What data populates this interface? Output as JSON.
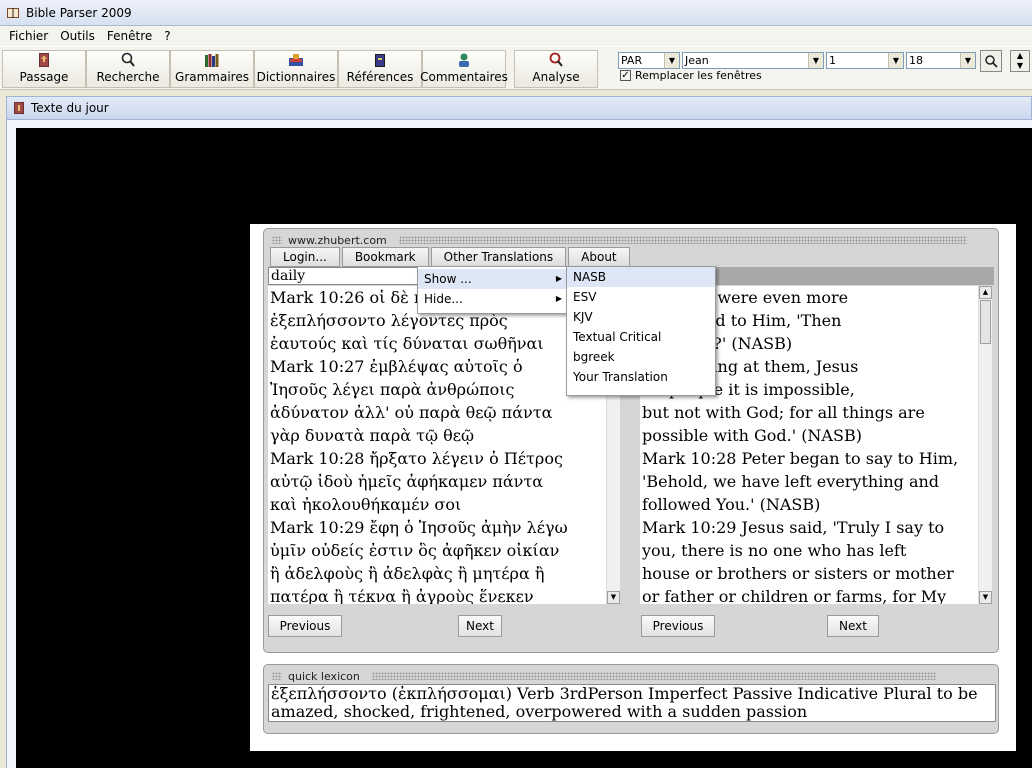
{
  "window": {
    "title": "Bible Parser 2009"
  },
  "menubar": {
    "items": [
      "Fichier",
      "Outils",
      "Fenêtre",
      "?"
    ]
  },
  "toolbar": {
    "buttons": [
      "Passage",
      "Recherche",
      "Grammaires",
      "Dictionnaires",
      "Références",
      "Commentaires",
      "Analyse"
    ],
    "version_select": "PAR",
    "book_select": "Jean",
    "chapter_select": "1",
    "verse_select": "18",
    "replace_windows_label": "Remplacer les fenêtres",
    "replace_windows_checked": true
  },
  "child_window": {
    "title": "Texte du jour"
  },
  "site": {
    "domain": "www.zhubert.com",
    "nav": [
      "Login...",
      "Bookmark",
      "Other Translations",
      "About"
    ],
    "daily_value": "daily"
  },
  "menu": {
    "show_label": "Show ...",
    "hide_label": "Hide...",
    "translations": [
      "NASB",
      "ESV",
      "KJV",
      "Textual Critical",
      "bgreek",
      "Your Translation"
    ]
  },
  "greek_lines": [
    "Mark 10:26 οἱ δὲ π",
    "ἐξεπλήσσοντο λέγοντες πρὸς",
    "ἑαυτούς καὶ τίς δύναται σωθῆναι",
    "Mark 10:27 ἐμβλέψας αὐτοῖς ὁ",
    "Ἰησοῦς λέγει παρὰ ἀνθρώποις",
    "ἀδύνατον ἀλλ' οὐ παρὰ θεῷ πάντα",
    "γὰρ δυνατὰ παρὰ τῷ θεῷ",
    "Mark 10:28 ἤρξατο λέγειν ὁ Πέτρος",
    "αὐτῷ ἰδοὺ ἡμεῖς ἀφήκαμεν πάντα",
    "καὶ ἠκολουθήκαμέν σοι",
    "Mark 10:29 ἔφη ὁ Ἰησοῦς ἀμὴν λέγω",
    "ὑμῖν οὐδείς ἐστιν ὃς ἀφῆκεν οἰκίαν",
    "ἢ ἀδελφοὺς ἢ ἀδελφὰς ἢ μητέρα ἢ",
    "πατέρα ἢ τέκνα ἢ ἀγροὺς ἕνεκεν"
  ],
  "english_lines": [
    ":26 They were even more",
    "d and said to Him, 'Then",
    "be saved?' (NASB)",
    ":27 Looking at them, Jesus",
    "ith people it is impossible,",
    "but not with God; for all things are",
    "possible with God.' (NASB)",
    "Mark 10:28 Peter began to say to Him,",
    "'Behold, we have left everything and",
    "followed You.' (NASB)",
    "Mark 10:29 Jesus said, 'Truly I say to",
    "you, there is no one who has left",
    "house or brothers or sisters or mother",
    "or father or children or farms, for My"
  ],
  "pager": {
    "previous": "Previous",
    "next": "Next"
  },
  "lexicon": {
    "title": "quick lexicon",
    "line1": "ἐξεπλήσσοντο (ἐκπλήσσομαι) Verb 3rdPerson Imperfect Passive Indicative Plural  to be",
    "line2": "amazed, shocked, frightened, overpowered with a sudden passion"
  }
}
